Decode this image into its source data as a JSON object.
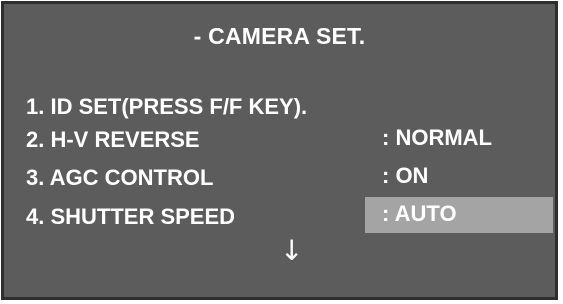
{
  "menu": {
    "title": "- CAMERA SET.",
    "items": [
      {
        "label": "1. ID SET(PRESS F/F KEY).",
        "value": ""
      },
      {
        "label": "2. H-V REVERSE",
        "value": ": NORMAL"
      },
      {
        "label": "3. AGC CONTROL",
        "value": ": ON"
      },
      {
        "label": "4. SHUTTER SPEED",
        "value": ": AUTO"
      }
    ],
    "selected_index": 3,
    "scroll_indicator": "↓",
    "scroll_icon": "arrow-down-icon"
  },
  "colors": {
    "background": "#5c5c5c",
    "border": "#2e2e2e",
    "highlight": "#a4a4a4",
    "text": "#ffffff"
  }
}
